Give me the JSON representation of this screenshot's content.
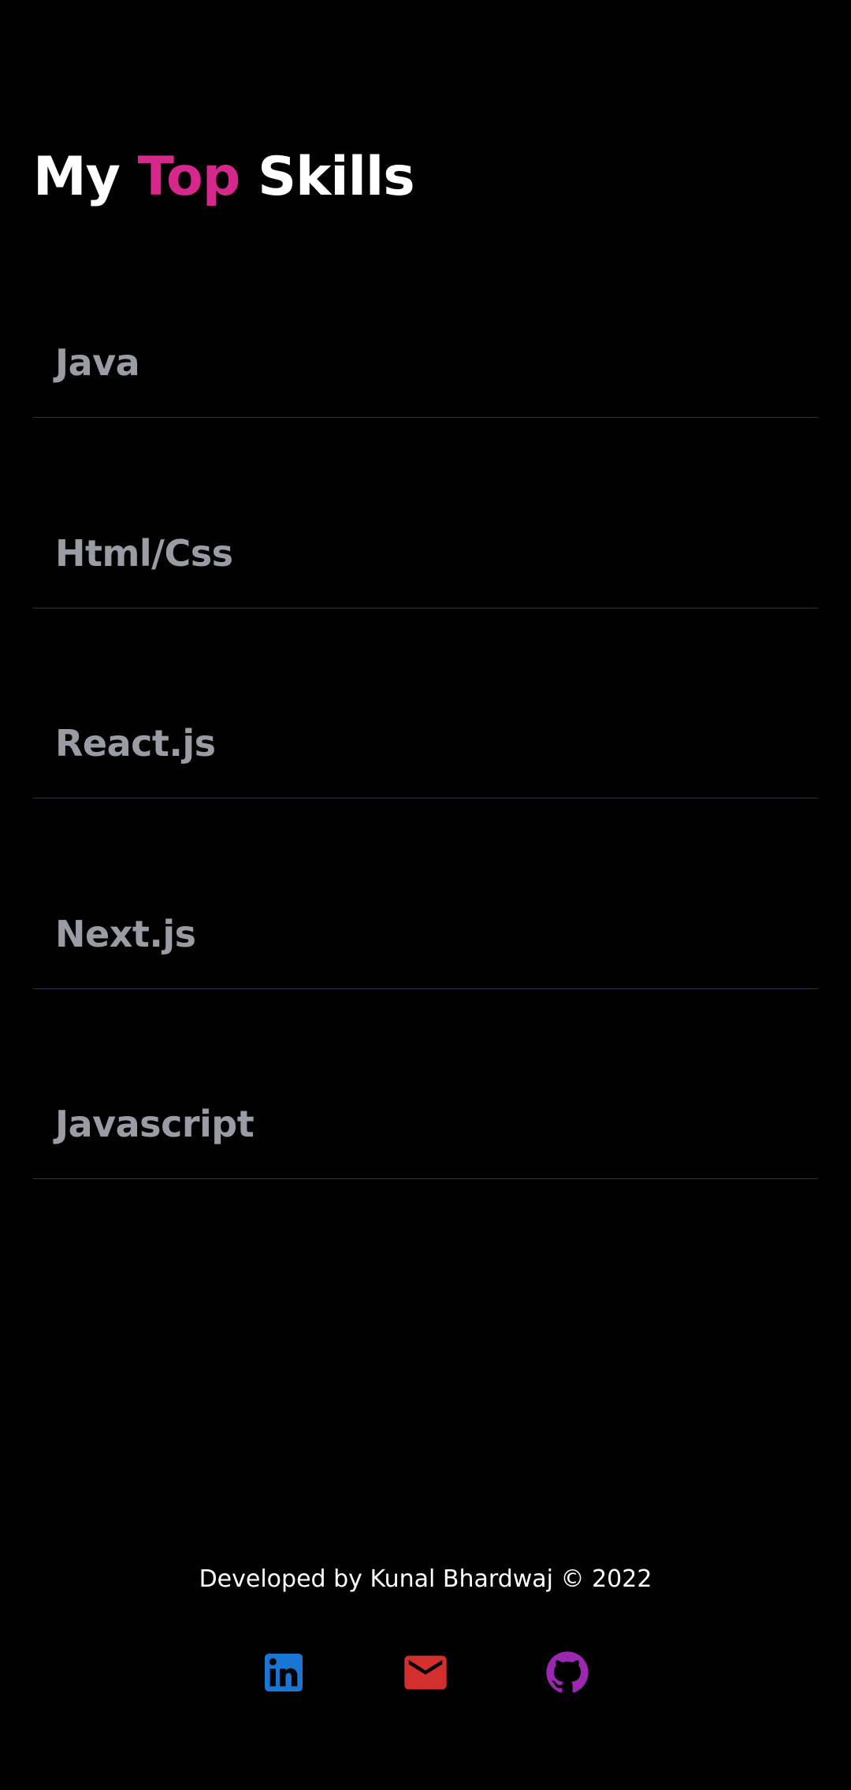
{
  "header": {
    "title_part1": "My ",
    "title_accent": "Top",
    "title_part2": " Skills"
  },
  "skills": [
    {
      "label": "Java"
    },
    {
      "label": "Html/Css"
    },
    {
      "label": "React.js"
    },
    {
      "label": "Next.js"
    },
    {
      "label": "Javascript"
    }
  ],
  "footer": {
    "credit": "Developed by Kunal Bhardwaj © 2022",
    "social": [
      {
        "name": "linkedin-icon",
        "color": "#1976d2"
      },
      {
        "name": "mail-icon",
        "color": "#d32f2f"
      },
      {
        "name": "github-icon",
        "color": "#9c27b0"
      }
    ]
  },
  "colors": {
    "background": "#000000",
    "accent": "#d6278a",
    "skill_text": "#9a9ca5",
    "divider": "#2f3340"
  }
}
